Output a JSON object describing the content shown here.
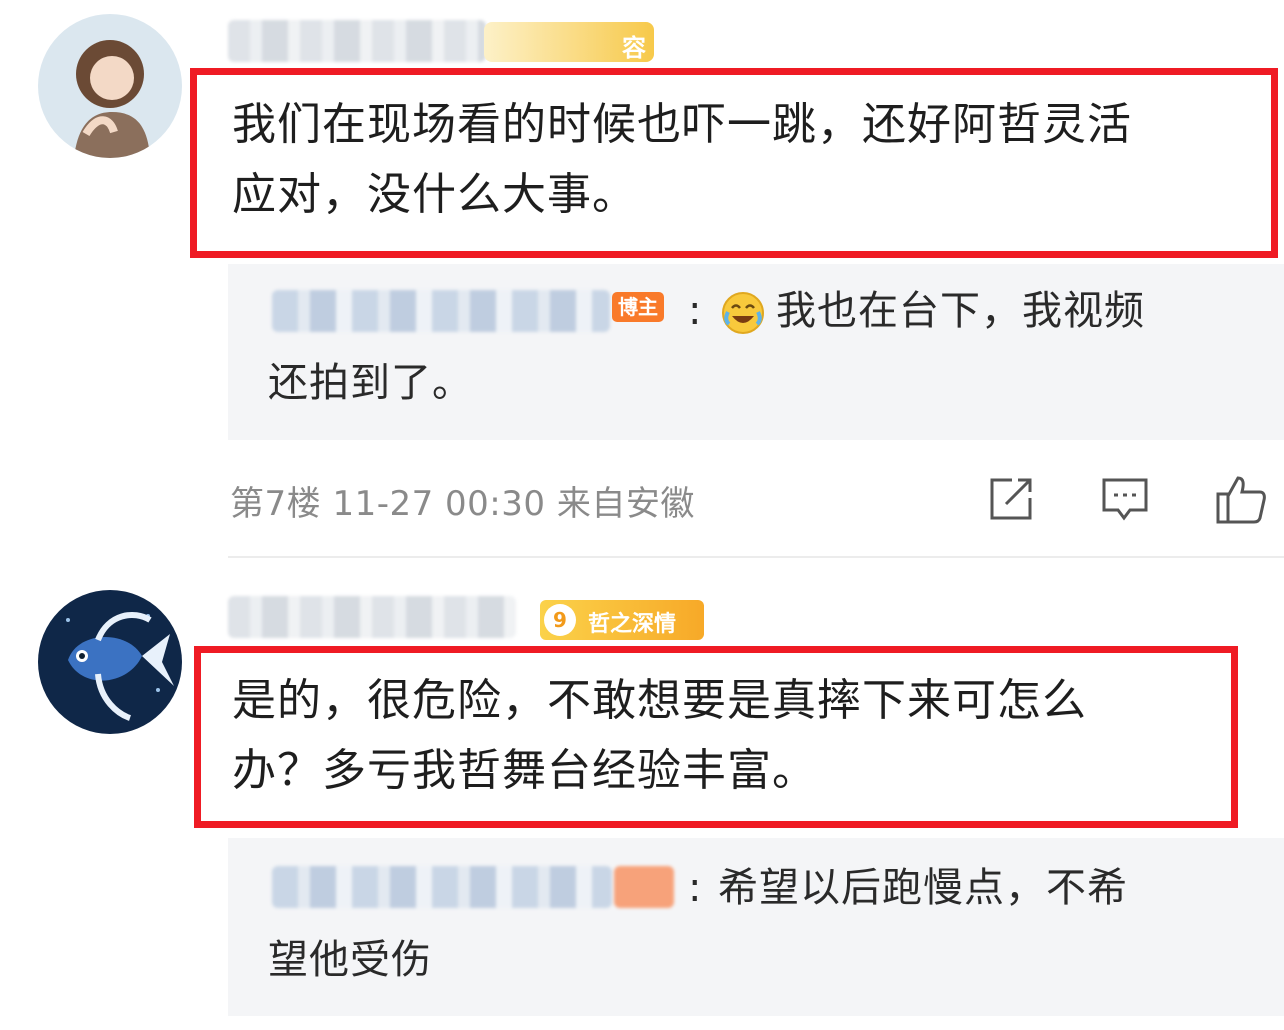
{
  "comment1": {
    "user_badge": "容",
    "text_line1": "我们在现场看的时候也吓一跳，还好阿哲灵活",
    "text_line2": "应对，没什么大事。",
    "reply": {
      "author_badge": "博主",
      "colon": ":",
      "text_line1": "我也在台下，我视频",
      "text_line2": "还拍到了。"
    },
    "meta": "第7楼 11-27 00:30 来自安徽"
  },
  "comment2": {
    "fan_level": "9",
    "fan_badge": "哲之深情",
    "text_line1": "是的，很危险，不敢想要是真摔下来可怎么",
    "text_line2": "办？多亏我哲舞台经验丰富。",
    "reply": {
      "colon": ":",
      "text_line1": "希望以后跑慢点，不希",
      "text_line2": "望他受伤"
    }
  },
  "icons": {
    "share": "share-icon",
    "comment": "comment-icon",
    "like": "like-icon",
    "laugh_cry": "laugh-cry-emoji-icon"
  },
  "colors": {
    "highlight_border": "#ef1b24",
    "blogger_badge": "#f97a2a",
    "fan_badge": "#f7b731"
  }
}
